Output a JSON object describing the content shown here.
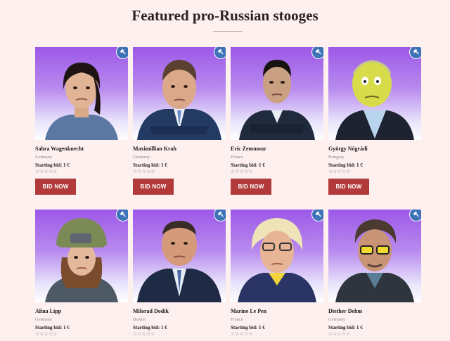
{
  "page": {
    "title": "Featured pro-Russian stooges"
  },
  "labels": {
    "starting_bid": "Starting bid: 1 €",
    "bid_button": "BID NOW",
    "stars": "☆☆☆☆☆"
  },
  "colors": {
    "accent": "#b23a3a",
    "gavel_badge": "#3f73b8",
    "background": "#fdf0ef"
  },
  "products": [
    {
      "name": "Sahra Wagenknecht",
      "country": "Germany",
      "icon": "gavel-icon"
    },
    {
      "name": "Maximillian Krah",
      "country": "Germany",
      "icon": "gavel-icon"
    },
    {
      "name": "Eric Zemmour",
      "country": "France",
      "icon": "gavel-icon"
    },
    {
      "name": "György Nógrádi",
      "country": "Hungary",
      "icon": "gavel-icon"
    },
    {
      "name": "Alina Lipp",
      "country": "Germany",
      "icon": "gavel-icon"
    },
    {
      "name": "Milorad Dodik",
      "country": "Bosnia",
      "icon": "gavel-icon"
    },
    {
      "name": "Marine Le Pen",
      "country": "France",
      "icon": "gavel-icon"
    },
    {
      "name": "Diether Dehm",
      "country": "Germany",
      "icon": "gavel-icon"
    }
  ]
}
